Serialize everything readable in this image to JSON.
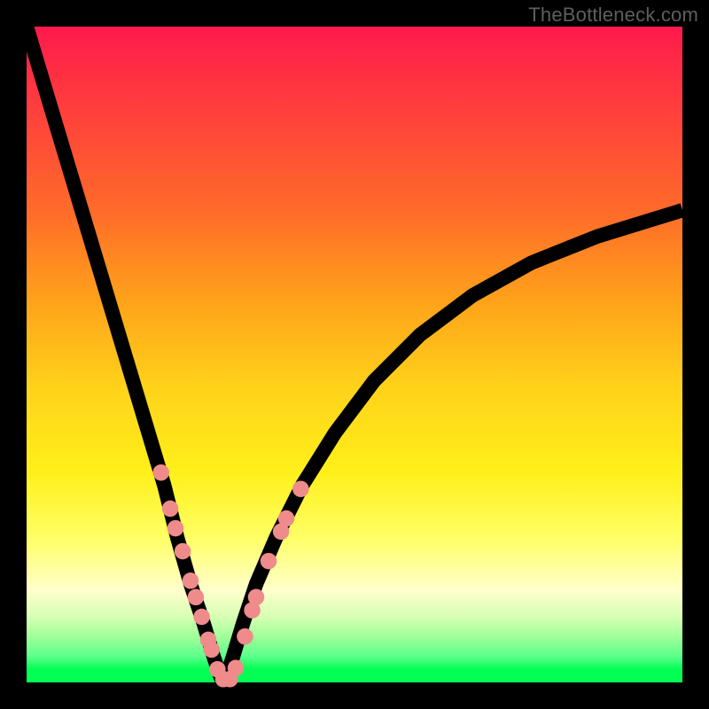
{
  "watermark": "TheBottleneck.com",
  "chart_data": {
    "type": "line",
    "title": "",
    "xlabel": "",
    "ylabel": "",
    "xlim": [
      0,
      100
    ],
    "ylim": [
      0,
      100
    ],
    "grid": false,
    "legend": false,
    "series": [
      {
        "name": "bottleneck-curve",
        "x": [
          0,
          3,
          6,
          9,
          12,
          15,
          18,
          21,
          23,
          25,
          27,
          28.5,
          29.5,
          30,
          30.5,
          31.5,
          33,
          35,
          38,
          42,
          47,
          53,
          60,
          68,
          77,
          87,
          100
        ],
        "y": [
          100,
          90,
          80,
          70,
          60,
          50,
          40,
          30,
          22,
          15,
          9,
          4,
          1,
          0,
          1,
          4,
          9,
          15,
          22,
          30,
          38,
          46,
          53,
          59,
          64,
          68,
          72
        ]
      }
    ],
    "markers": {
      "name": "beads",
      "color": "#ef8b8b",
      "points_xy": [
        [
          20.5,
          32
        ],
        [
          21.9,
          26.5
        ],
        [
          22.7,
          23.5
        ],
        [
          23.8,
          20
        ],
        [
          25.0,
          15.5
        ],
        [
          25.8,
          13
        ],
        [
          26.7,
          10
        ],
        [
          27.7,
          6.5
        ],
        [
          28.2,
          5
        ],
        [
          29.1,
          2
        ],
        [
          30.0,
          0.5
        ],
        [
          31.0,
          0.5
        ],
        [
          31.9,
          2.2
        ],
        [
          33.3,
          7
        ],
        [
          34.4,
          11
        ],
        [
          35.0,
          13
        ],
        [
          36.9,
          18.5
        ],
        [
          38.8,
          23
        ],
        [
          39.6,
          25
        ],
        [
          41.8,
          29.5
        ]
      ]
    }
  }
}
